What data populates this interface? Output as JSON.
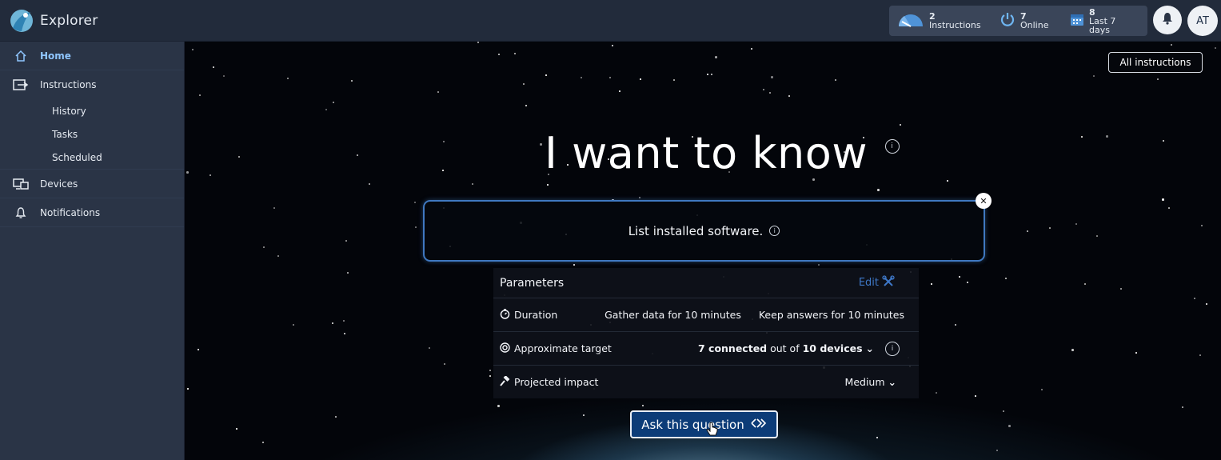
{
  "app": {
    "title": "Explorer"
  },
  "stats": [
    {
      "count": "2",
      "label": "Instructions",
      "icon": "gauge-icon"
    },
    {
      "count": "7",
      "label": "Online",
      "icon": "power-icon"
    },
    {
      "count": "8",
      "label": "Last 7 days",
      "icon": "calendar-icon"
    }
  ],
  "user": {
    "initials": "AT"
  },
  "sidebar": {
    "home": "Home",
    "instructions": "Instructions",
    "history": "History",
    "tasks": "Tasks",
    "scheduled": "Scheduled",
    "devices": "Devices",
    "notifications": "Notifications"
  },
  "main": {
    "all_instructions": "All instructions",
    "headline": "I want to know",
    "query": "List installed software."
  },
  "parameters": {
    "title": "Parameters",
    "edit": "Edit",
    "duration": {
      "label": "Duration",
      "gather": "Gather data for 10 minutes",
      "keep": "Keep answers for 10 minutes"
    },
    "target": {
      "label": "Approximate target",
      "connected": "7 connected",
      "out_of": "out of",
      "total": "10 devices"
    },
    "impact": {
      "label": "Projected impact",
      "value": "Medium"
    }
  },
  "actions": {
    "ask": "Ask this question"
  },
  "colors": {
    "accent": "#3f78c0",
    "sidebar": "#2a3446",
    "topbar": "#222b3b",
    "active_nav": "#8fc6ff"
  }
}
